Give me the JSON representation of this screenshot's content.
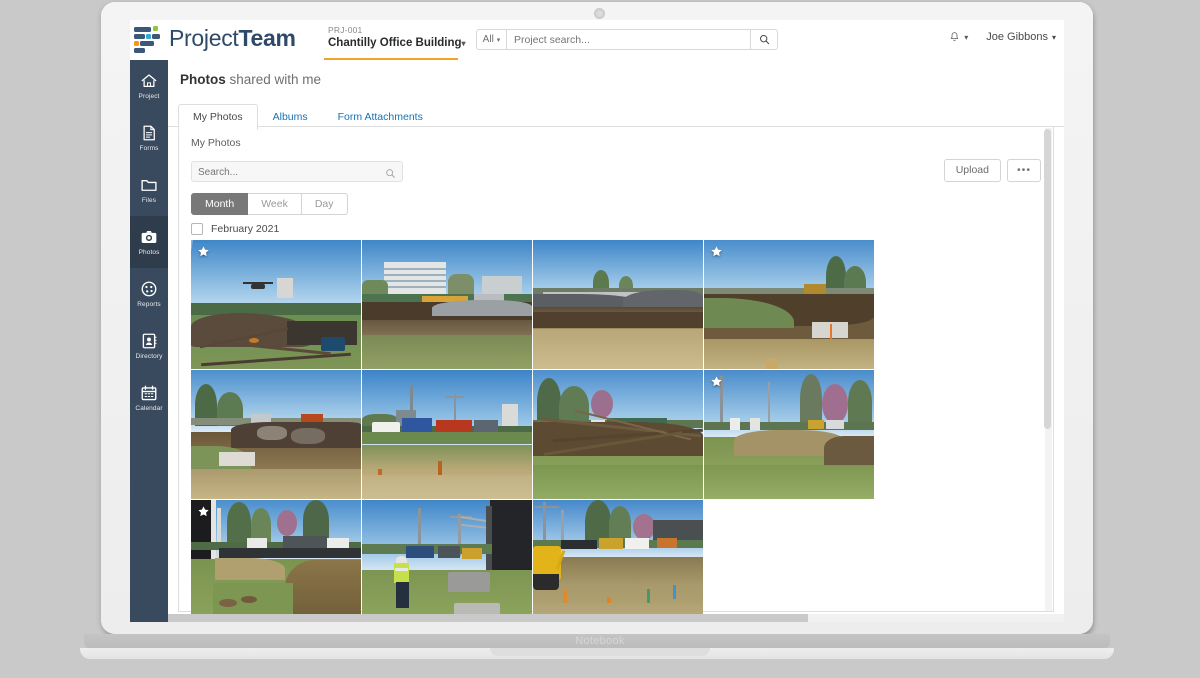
{
  "device": {
    "label": "Notebook"
  },
  "header": {
    "logo_text_light": "Project",
    "logo_text_bold": "Team",
    "project_code": "PRJ-001",
    "project_name": "Chantilly Office Building",
    "project_caret": "▾",
    "search": {
      "scope_label": "All",
      "scope_caret": "▾",
      "placeholder": "Project search...",
      "value": "",
      "button_icon": "search-icon"
    },
    "notifications_icon": "bell-icon",
    "notifications_caret": "▾",
    "user_name": "Joe Gibbons",
    "user_caret": "▾"
  },
  "sidebar": {
    "items": [
      {
        "label": "Project",
        "icon": "home-icon",
        "active": false
      },
      {
        "label": "Forms",
        "icon": "document-icon",
        "active": false
      },
      {
        "label": "Files",
        "icon": "folder-icon",
        "active": false
      },
      {
        "label": "Photos",
        "icon": "camera-icon",
        "active": true
      },
      {
        "label": "Reports",
        "icon": "pie-chart-icon",
        "active": false
      },
      {
        "label": "Directory",
        "icon": "contacts-icon",
        "active": false
      },
      {
        "label": "Calendar",
        "icon": "calendar-icon",
        "active": false
      }
    ]
  },
  "page": {
    "title_bold": "Photos",
    "title_rest": " shared with me",
    "tabs": [
      {
        "label": "My Photos",
        "active": true
      },
      {
        "label": "Albums",
        "active": false
      },
      {
        "label": "Form Attachments",
        "active": false
      }
    ]
  },
  "panel": {
    "title": "My Photos",
    "search_placeholder": "Search...",
    "search_value": "",
    "search_icon": "search-icon",
    "view_modes": [
      {
        "label": "Month",
        "active": true
      },
      {
        "label": "Week",
        "active": false
      },
      {
        "label": "Day",
        "active": false
      }
    ],
    "upload_label": "Upload",
    "more_label": "•••",
    "group": {
      "checkbox_checked": false,
      "label": "February 2021"
    },
    "photos": [
      {
        "alt": "helicopter-over-cleared-lot",
        "starred": true,
        "scene": "helicopter"
      },
      {
        "alt": "office-building-behind-grading",
        "starred": false,
        "scene": "building"
      },
      {
        "alt": "gravel-pile-and-graded-site",
        "starred": false,
        "scene": "gravel"
      },
      {
        "alt": "earth-berm-with-barrier",
        "starred": true,
        "scene": "berm"
      },
      {
        "alt": "excavated-rock-pile",
        "starred": false,
        "scene": "rockpile"
      },
      {
        "alt": "equipment-and-blue-container",
        "starred": false,
        "scene": "container"
      },
      {
        "alt": "felled-tree-branches-pile",
        "starred": false,
        "scene": "branches"
      },
      {
        "alt": "cleared-lot-with-stumps",
        "starred": true,
        "scene": "stumps"
      },
      {
        "alt": "black-fence-and-trench",
        "starred": true,
        "scene": "fence"
      },
      {
        "alt": "worker-in-vest-by-fence",
        "starred": false,
        "scene": "worker"
      },
      {
        "alt": "excavator-on-staked-lot",
        "starred": false,
        "scene": "excavator"
      }
    ]
  },
  "colors": {
    "brand_navy": "#2f4a68",
    "sidebar": "#3a4a5e",
    "sidebar_active": "#2e3c4c",
    "accent_orange": "#f0a42a",
    "link_blue": "#1473b5",
    "segment_active": "#787878"
  }
}
